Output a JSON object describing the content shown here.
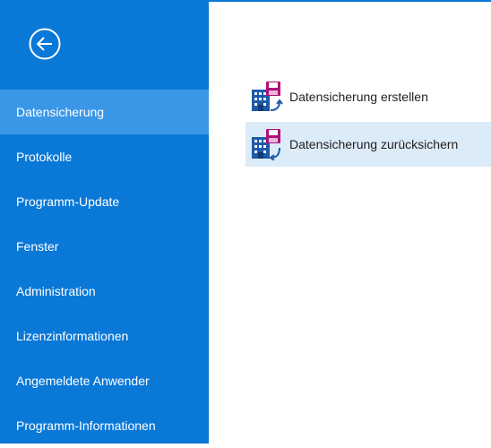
{
  "sidebar": {
    "back_button": {
      "icon": "back-arrow-circle-icon"
    },
    "items": [
      {
        "label": "Datensicherung",
        "active": true
      },
      {
        "label": "Protokolle",
        "active": false
      },
      {
        "label": "Programm-Update",
        "active": false
      },
      {
        "label": "Fenster",
        "active": false
      },
      {
        "label": "Administration",
        "active": false
      },
      {
        "label": "Lizenzinformationen",
        "active": false
      },
      {
        "label": "Angemeldete Anwender",
        "active": false
      },
      {
        "label": "Programm-Informationen",
        "active": false
      }
    ]
  },
  "main": {
    "commands": [
      {
        "label": "Datensicherung erstellen",
        "icon": "backup-create-icon",
        "selected": false
      },
      {
        "label": "Datensicherung zurücksichern",
        "icon": "backup-restore-icon",
        "selected": true
      }
    ]
  },
  "colors": {
    "accent": "#0a78d7",
    "sidebar_active": "#3a97e7",
    "selection": "#dcebf8",
    "icon_blue": "#1e5aa8",
    "icon_magenta": "#b0107a"
  }
}
